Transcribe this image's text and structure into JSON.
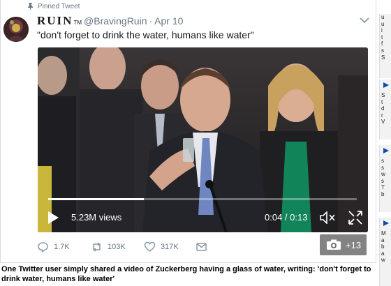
{
  "tweet": {
    "pinned_label": "Pinned Tweet",
    "display_name": "RUIN",
    "trademark": "TM",
    "handle": "@BravingRuin",
    "separator": "·",
    "date": "Apr 10",
    "text": "\"don't forget to drink the water, humans like water\""
  },
  "video": {
    "views": "5.23M views",
    "time": "0:04 / 0:13",
    "progress": 0.31,
    "photo_badge_count": "+13"
  },
  "actions": {
    "reply_count": "1.7K",
    "retweet_count": "103K",
    "like_count": "317K"
  },
  "caption": "One Twitter user simply shared a video of Zuckerberg having a glass of water, writing: 'don't forget to drink water, humans like water'",
  "sidebar": {
    "blocks": [
      {
        "lines": [
          "u",
          "u",
          "i",
          "t",
          "f",
          "s",
          "S"
        ],
        "blue_lines": []
      },
      {
        "lines": [
          "S",
          "t",
          "d",
          "r",
          "V"
        ],
        "blue_lines": [
          "V"
        ]
      },
      {
        "lines": [
          "s",
          "s",
          "w",
          "s",
          "T",
          "b"
        ],
        "blue_lines": []
      },
      {
        "lines": [
          "M",
          "a",
          "b",
          "a",
          "w"
        ],
        "blue_lines": []
      }
    ]
  },
  "colors": {
    "muted_text": "#657786",
    "border": "#d8dde1",
    "sidebar_link": "#0a4ea3"
  },
  "icons": {
    "pin": "pin-icon",
    "chevron": "chevron-down-icon",
    "play": "play-icon",
    "mute": "mute-icon",
    "expand": "expand-icon",
    "camera": "camera-icon",
    "reply": "reply-icon",
    "retweet": "retweet-icon",
    "like": "heart-icon",
    "message": "envelope-icon"
  }
}
